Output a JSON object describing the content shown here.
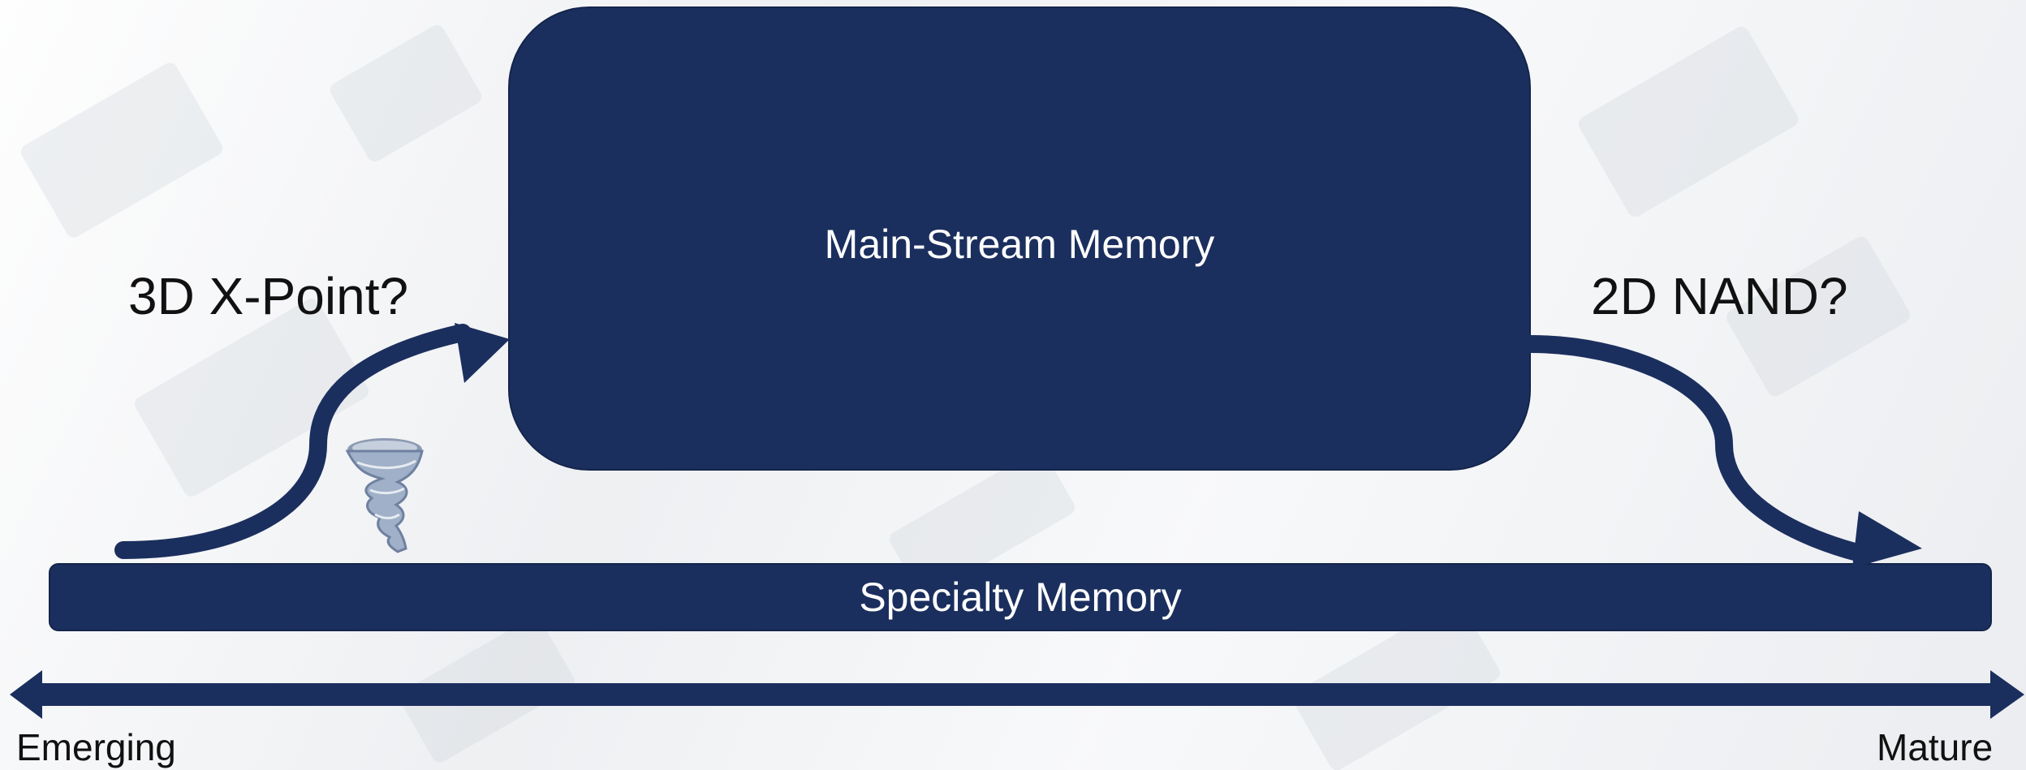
{
  "diagram": {
    "main_box_label": "Main-Stream Memory",
    "specialty_bar_label": "Specialty Memory",
    "left_label": "3D X-Point?",
    "right_label": "2D NAND?",
    "axis_left_label": "Emerging",
    "axis_right_label": "Mature"
  },
  "colors": {
    "box_fill": "#1b2f5e",
    "arrow": "#1b2f5e",
    "text": "#111111"
  },
  "icons": {
    "tornado": "tornado-icon"
  }
}
